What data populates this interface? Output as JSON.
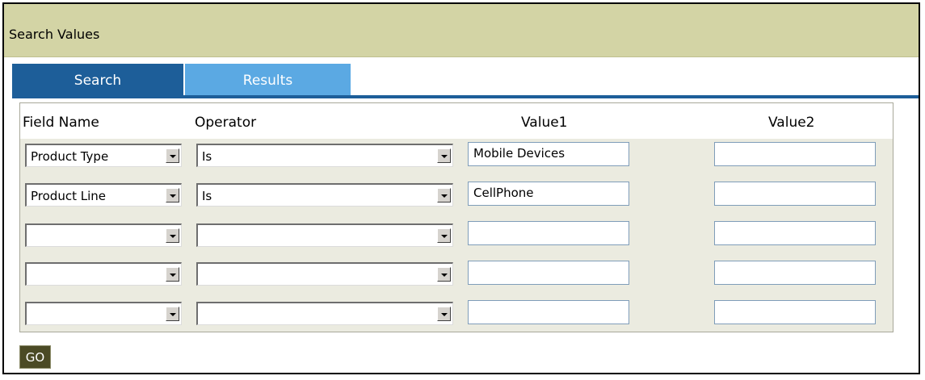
{
  "window": {
    "title": "Search Values"
  },
  "tabs": [
    {
      "label": "Search",
      "active": true
    },
    {
      "label": "Results",
      "active": false
    }
  ],
  "table": {
    "headers": {
      "field": "Field Name",
      "operator": "Operator",
      "value1": "Value1",
      "value2": "Value2"
    },
    "rows": [
      {
        "field": "Product Type",
        "operator": "Is",
        "value1": "Mobile Devices",
        "value2": ""
      },
      {
        "field": "Product Line",
        "operator": "Is",
        "value1": "CellPhone",
        "value2": ""
      },
      {
        "field": "",
        "operator": "",
        "value1": "",
        "value2": ""
      },
      {
        "field": "",
        "operator": "",
        "value1": "",
        "value2": ""
      },
      {
        "field": "",
        "operator": "",
        "value1": "",
        "value2": ""
      }
    ]
  },
  "actions": {
    "go_label": "GO"
  },
  "colors": {
    "title_bar": "#d3d4a5",
    "tab_active": "#1d5e99",
    "tab_inactive": "#5ba9e3",
    "panel_bg": "#ebebe0",
    "go_button": "#4b4a25"
  }
}
